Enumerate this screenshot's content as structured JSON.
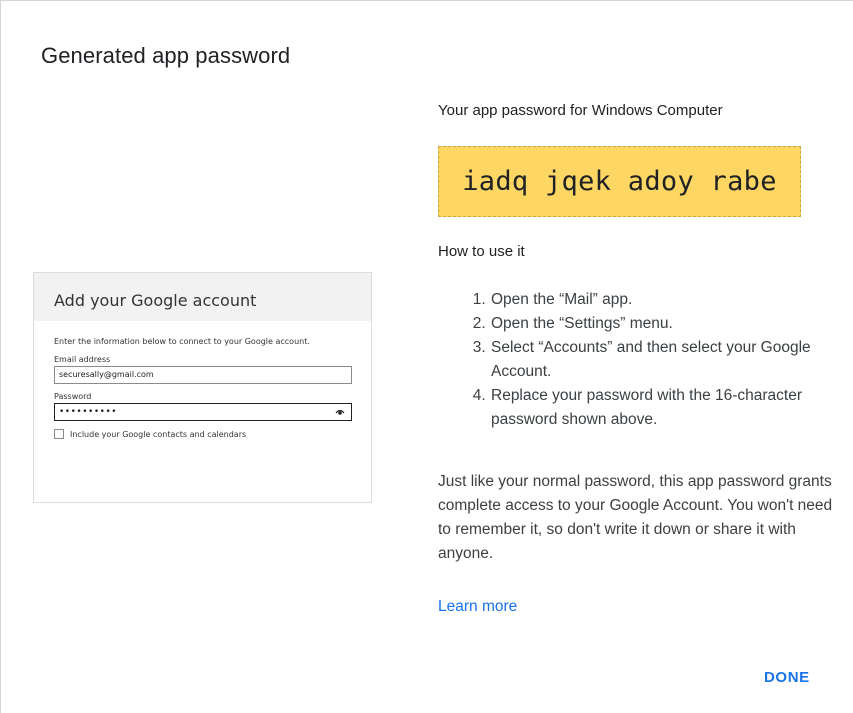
{
  "dialog": {
    "title": "Generated app password",
    "done_label": "DONE"
  },
  "password_panel": {
    "heading": "Your app password for Windows Computer",
    "password": "iadq jqek adoy rabe",
    "accent_color": "#fdd663"
  },
  "instructions": {
    "heading": "How to use it",
    "steps": [
      "Open the “Mail” app.",
      "Open the “Settings” menu.",
      "Select “Accounts” and then select your Google Account.",
      "Replace your password with the 16-character password shown above."
    ],
    "description": "Just like your normal password, this app password grants complete access to your Google Account. You won't need to remember it, so don't write it down or share it with anyone.",
    "learn_more": "Learn more"
  },
  "illustration": {
    "title": "Add your Google account",
    "intro": "Enter the information below to connect to your Google account.",
    "email_label": "Email address",
    "email_value": "securesally@gmail.com",
    "password_label": "Password",
    "password_value": "••••••••••",
    "checkbox_label": "Include your Google contacts and calendars"
  }
}
